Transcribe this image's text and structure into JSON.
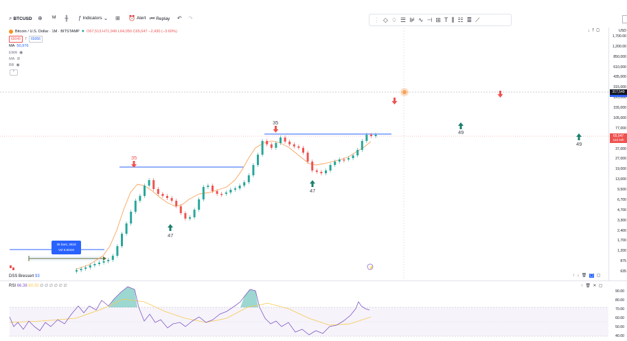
{
  "toolbar": {
    "symbol": "BTCUSD",
    "interval": "M",
    "indicators_label": "Indicators",
    "alert_label": "Alert",
    "replay_label": "Replay"
  },
  "legend": {
    "title": "Bitcoin / U.S. Dollar · 1M · BITSTAMP",
    "ohlc": "O67,513 H71,949 L64,050 C65,047 −2,430 (−3.60%)",
    "sell_price": "65049",
    "spread": "7",
    "buy_price": "65056",
    "indicators": [
      {
        "name": "MA",
        "value": "50,976"
      },
      {
        "name": "EMA",
        "value": ""
      },
      {
        "name": "MA",
        "value": ""
      },
      {
        "name": "BB",
        "value": ""
      }
    ]
  },
  "price_axis": {
    "currency": "USD",
    "ticks": [
      "1,700.00",
      "1,200.00",
      "850,000",
      "610,000",
      "435,000",
      "315,000",
      "225,000",
      "155,000",
      "105,000",
      "77,000",
      "55,000",
      "37,000",
      "27,000",
      "19,000",
      "13,000",
      "9,500",
      "6,700",
      "4,700",
      "3,300",
      "2,400",
      "1,700",
      "1,200",
      "875",
      "635"
    ],
    "crosshair_price": "317,549",
    "last_price": "65,047",
    "last_price_sub": "12d 10h"
  },
  "annotations": {
    "label_35a": "35",
    "label_35b": "35",
    "label_47a": "47",
    "label_47b": "47",
    "label_49a": "49",
    "label_49b": "49",
    "date_range": "35 bars, 362d",
    "volume": "Vol 8.831M"
  },
  "lower_panes": {
    "dss_label": "DSS Bressert",
    "dss_value": "93",
    "rsi_label": "RSI",
    "rsi_value": "66.38",
    "rsi_value2": "60.33",
    "rsi_extra": "∅ ∅ ∅ ∅ ∅ ∅",
    "rsi_ticks": [
      "90.00",
      "80.00",
      "70.00",
      "60.00",
      "50.00",
      "40.00"
    ]
  },
  "colors": {
    "up": "#26a69a",
    "down": "#ef5350",
    "ma": "#f7a35c",
    "level": "#2962ff",
    "rsi": "#7e57c2"
  }
}
